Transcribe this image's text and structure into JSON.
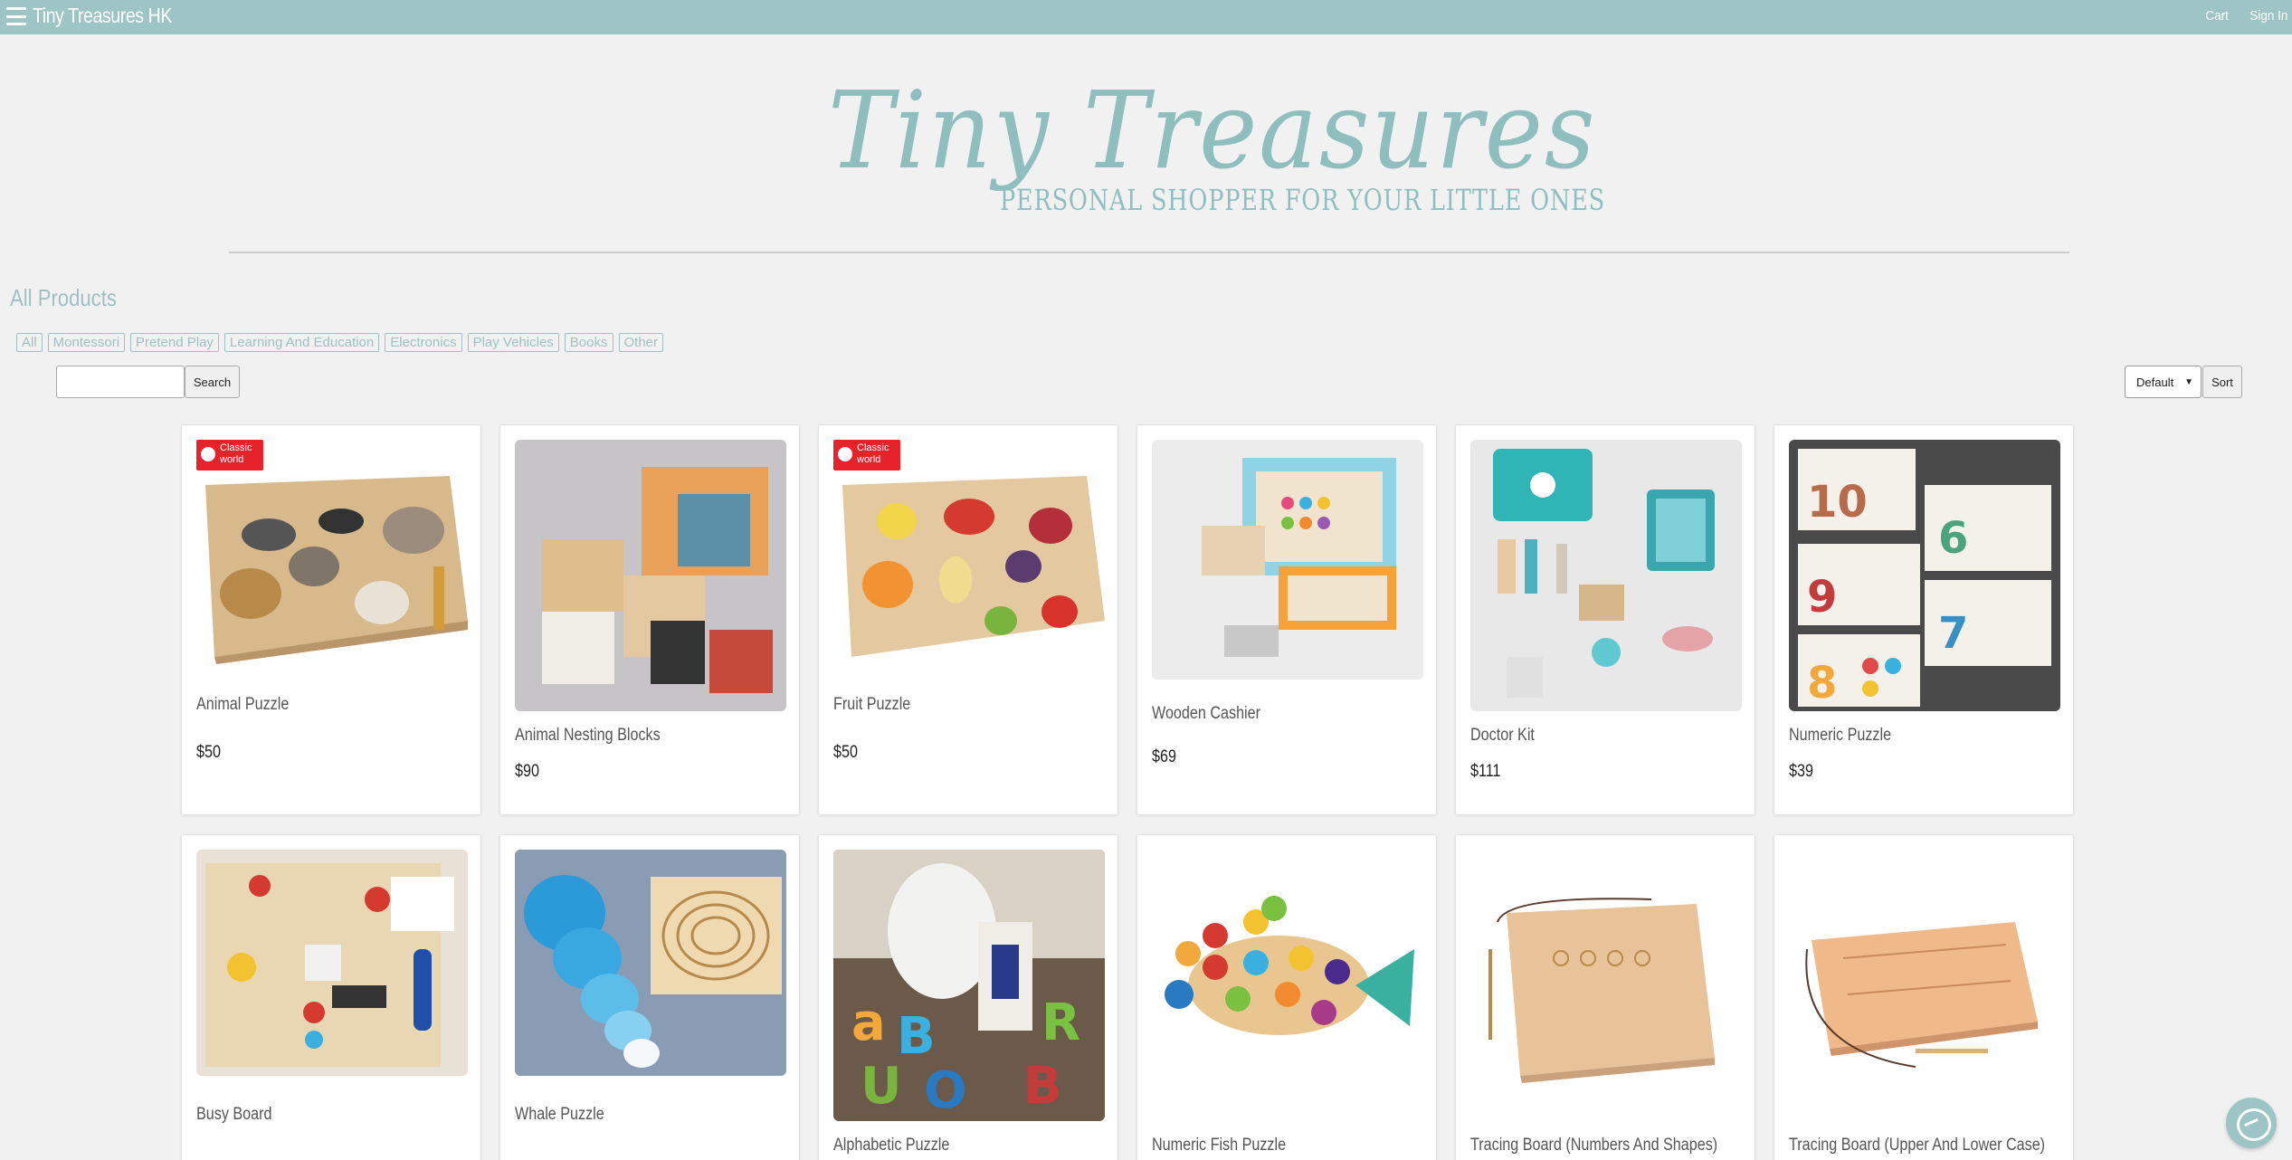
{
  "header": {
    "brand": "Tiny Treasures HK",
    "nav": {
      "cart": "Cart",
      "sign_in": "Sign In"
    }
  },
  "hero": {
    "script_title": "Tiny Treasures",
    "subtitle": "Personal Shopper For Your Little Ones"
  },
  "products_section": {
    "title": "All Products",
    "filters": [
      "All",
      "Montessori",
      "Pretend Play",
      "Learning And Education",
      "Electronics",
      "Play Vehicles",
      "Books",
      "Other"
    ],
    "search": {
      "value": "",
      "button_label": "Search"
    },
    "sort": {
      "selected": "Default",
      "button_label": "Sort"
    }
  },
  "products": [
    {
      "name": "Animal Puzzle",
      "price": "$50",
      "badge": "Classic world",
      "image": "animal-puzzle-image"
    },
    {
      "name": "Animal Nesting Blocks",
      "price": "$90",
      "image": "animal-nesting-blocks-image"
    },
    {
      "name": "Fruit Puzzle",
      "price": "$50",
      "badge": "Classic world",
      "image": "fruit-puzzle-image"
    },
    {
      "name": "Wooden Cashier",
      "price": "$69",
      "image": "wooden-cashier-image"
    },
    {
      "name": "Doctor Kit",
      "price": "$111",
      "image": "doctor-kit-image"
    },
    {
      "name": "Numeric Puzzle",
      "price": "$39",
      "image": "numeric-puzzle-image"
    },
    {
      "name": "Busy Board",
      "price": "",
      "image": "busy-board-image"
    },
    {
      "name": "Whale Puzzle",
      "price": "",
      "image": "whale-puzzle-image"
    },
    {
      "name": "Alphabetic Puzzle",
      "price": "",
      "image": "alphabetic-puzzle-image"
    },
    {
      "name": "Numeric Fish Puzzle",
      "price": "",
      "image": "numeric-fish-puzzle-image"
    },
    {
      "name": "Tracing Board (Numbers And Shapes)",
      "price": "",
      "image": "tracing-board-numbers-image"
    },
    {
      "name": "Tracing Board (Upper And Lower Case)",
      "price": "",
      "image": "tracing-board-letters-image"
    }
  ],
  "icons": {
    "menu": "hamburger-menu-icon",
    "messenger": "messenger-chat-icon"
  },
  "colors": {
    "topbar": "#9dc5c5",
    "accent": "#9fc1c3",
    "background": "#f1f1f1",
    "badge": "#e6232a"
  }
}
